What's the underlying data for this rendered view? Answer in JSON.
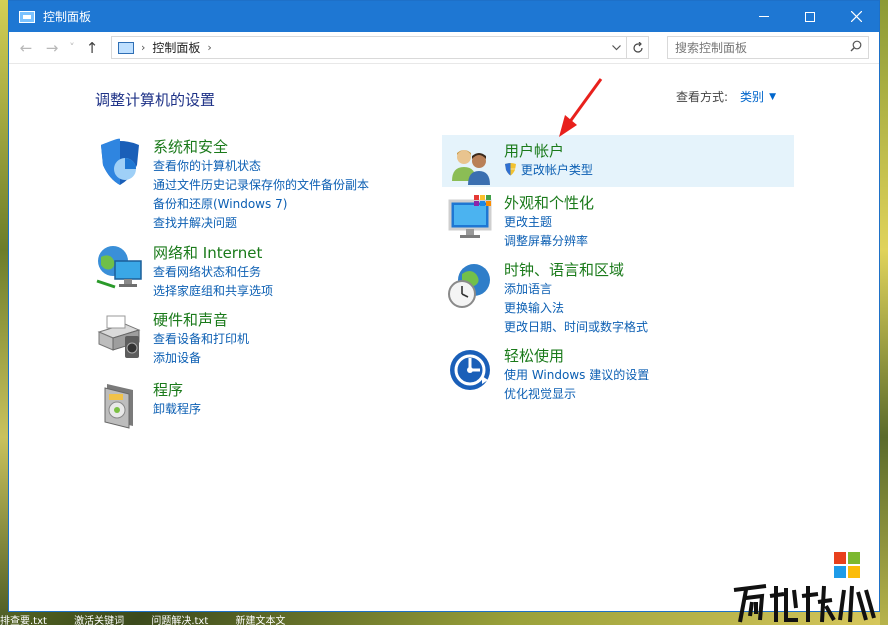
{
  "window": {
    "title": "控制面板"
  },
  "address": {
    "path": "控制面板",
    "nav_back": "←",
    "nav_forward": "→",
    "nav_dropdown": "˅",
    "nav_up": "↑"
  },
  "search": {
    "placeholder": "搜索控制面板"
  },
  "main": {
    "heading": "调整计算机的设置",
    "view_by_label": "查看方式:",
    "view_by_value": "类别"
  },
  "categories": {
    "security": {
      "title": "系统和安全",
      "links": [
        "查看你的计算机状态",
        "通过文件历史记录保存你的文件备份副本",
        "备份和还原(Windows 7)",
        "查找并解决问题"
      ]
    },
    "network": {
      "title": "网络和 Internet",
      "links": [
        "查看网络状态和任务",
        "选择家庭组和共享选项"
      ]
    },
    "hardware": {
      "title": "硬件和声音",
      "links": [
        "查看设备和打印机",
        "添加设备"
      ]
    },
    "programs": {
      "title": "程序",
      "links": [
        "卸载程序"
      ]
    },
    "users": {
      "title": "用户帐户",
      "links": [
        "更改帐户类型"
      ]
    },
    "appearance": {
      "title": "外观和个性化",
      "links": [
        "更改主题",
        "调整屏幕分辨率"
      ]
    },
    "clock": {
      "title": "时钟、语言和区域",
      "links": [
        "添加语言",
        "更换输入法",
        "更改日期、时间或数字格式"
      ]
    },
    "ease": {
      "title": "轻松使用",
      "links": [
        "使用 Windows 建议的设置",
        "优化视觉显示"
      ]
    }
  },
  "desktop": {
    "taskbar_items": [
      "排查要.txt",
      "激活关键词",
      "问题解决.txt",
      "新建文本文"
    ]
  },
  "colors": {
    "titlebar": "#1e77d3",
    "category_title": "#1a7a1a",
    "link": "#0c5fb3",
    "heading": "#1e3287",
    "highlight": "#e5f3fb",
    "arrow": "#e8201c"
  }
}
